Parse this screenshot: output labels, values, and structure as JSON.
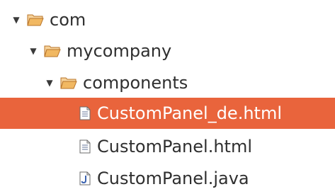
{
  "tree": {
    "items": [
      {
        "label": "com",
        "type": "package",
        "expanded": true,
        "icon": "folder-open-icon"
      },
      {
        "label": "mycompany",
        "type": "package",
        "expanded": true,
        "icon": "folder-open-icon"
      },
      {
        "label": "components",
        "type": "package",
        "expanded": true,
        "icon": "folder-open-icon"
      },
      {
        "label": "CustomPanel_de.html",
        "type": "file",
        "selected": true,
        "icon": "html-file-icon"
      },
      {
        "label": "CustomPanel.html",
        "type": "file",
        "selected": false,
        "icon": "html-file-icon"
      },
      {
        "label": "CustomPanel.java",
        "type": "file",
        "selected": false,
        "icon": "java-file-icon"
      }
    ]
  },
  "colors": {
    "selection": "#e9643c",
    "folder": "#e8a04a",
    "text": "#2f2f2f"
  }
}
